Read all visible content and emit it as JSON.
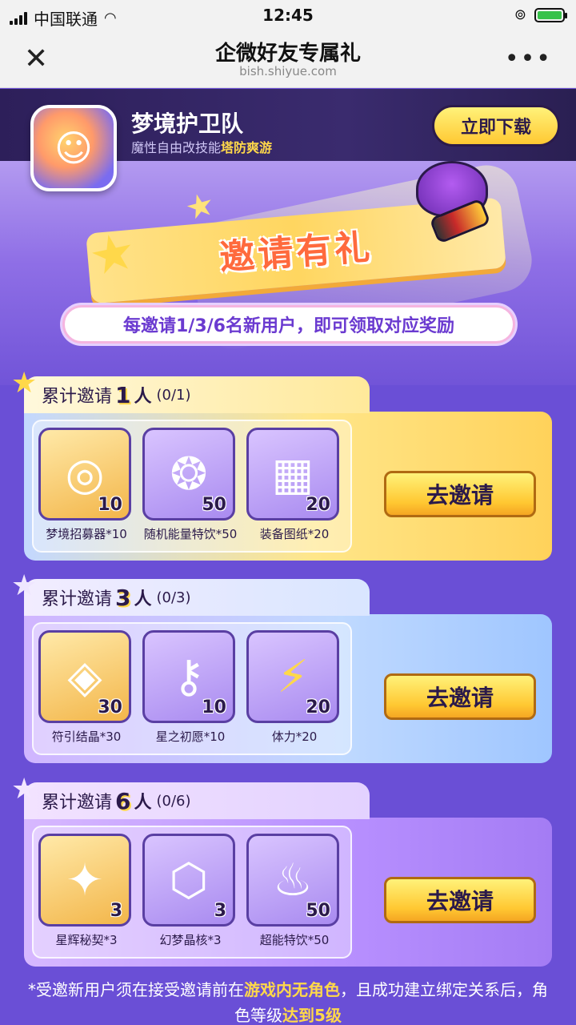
{
  "status_bar": {
    "carrier": "中国联通",
    "time": "12:45",
    "battery_level": 1.0
  },
  "nav": {
    "title": "企微好友专属礼",
    "url": "bish.shiyue.com"
  },
  "app": {
    "name": "梦境护卫队",
    "subtitle_prefix": "魔性自由改技能",
    "subtitle_highlight": "塔防爽游",
    "download_label": "立即下载"
  },
  "hero": {
    "banner_text": "邀请有礼",
    "subtitle": "每邀请1/3/6名新用户，即可领取对应奖励"
  },
  "tiers": [
    {
      "prefix": "累计邀请",
      "count": "1",
      "unit": "人",
      "progress": "(0/1)",
      "button": "去邀请",
      "items": [
        {
          "icon": "recruiter-icon",
          "qty": "10",
          "label": "梦境招募器*10"
        },
        {
          "icon": "energy-drink-icon",
          "qty": "50",
          "label": "随机能量特饮*50"
        },
        {
          "icon": "blueprint-icon",
          "qty": "20",
          "label": "装备图纸*20"
        }
      ]
    },
    {
      "prefix": "累计邀请",
      "count": "3",
      "unit": "人",
      "progress": "(0/3)",
      "button": "去邀请",
      "items": [
        {
          "icon": "crystal-icon",
          "qty": "30",
          "label": "符引结晶*30"
        },
        {
          "icon": "key-icon",
          "qty": "10",
          "label": "星之初愿*10"
        },
        {
          "icon": "lightning-icon",
          "qty": "20",
          "label": "体力*20"
        }
      ]
    },
    {
      "prefix": "累计邀请",
      "count": "6",
      "unit": "人",
      "progress": "(0/6)",
      "button": "去邀请",
      "items": [
        {
          "icon": "star-key-icon",
          "qty": "3",
          "label": "星辉秘契*3"
        },
        {
          "icon": "cube-icon",
          "qty": "3",
          "label": "幻梦晶核*3"
        },
        {
          "icon": "bottle-icon",
          "qty": "50",
          "label": "超能特饮*50"
        }
      ]
    }
  ],
  "footnote": {
    "part1": "*受邀新用户须在接受邀请前在",
    "highlight1": "游戏内无角色",
    "part2": "，且成功建立绑定关系后，角色等级",
    "highlight2": "达到5级"
  }
}
